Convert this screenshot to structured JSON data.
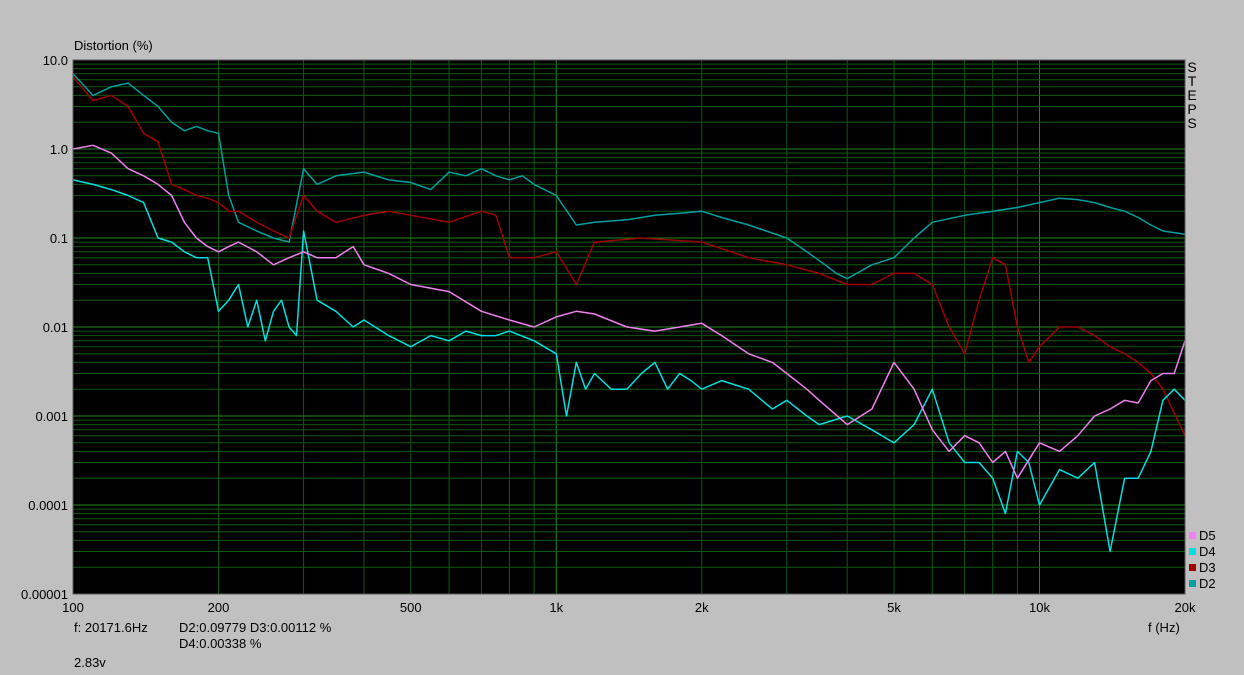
{
  "chart_data": {
    "type": "line",
    "title": "",
    "ylabel": "Distortion (%)",
    "xlabel": "f (Hz)",
    "x_scale": "log",
    "y_scale": "log",
    "xlim": [
      100,
      20000
    ],
    "ylim": [
      1e-05,
      10
    ],
    "grid": true,
    "legend_position": "bottom-right",
    "x_ticks": [
      {
        "value": 100,
        "label": "100"
      },
      {
        "value": 200,
        "label": "200"
      },
      {
        "value": 500,
        "label": "500"
      },
      {
        "value": 1000,
        "label": "1k"
      },
      {
        "value": 2000,
        "label": "2k"
      },
      {
        "value": 5000,
        "label": "5k"
      },
      {
        "value": 10000,
        "label": "10k"
      },
      {
        "value": 20000,
        "label": "20k"
      }
    ],
    "y_ticks": [
      {
        "value": 10,
        "label": "10.0"
      },
      {
        "value": 1,
        "label": "1.0"
      },
      {
        "value": 0.1,
        "label": "0.1"
      },
      {
        "value": 0.01,
        "label": "0.01"
      },
      {
        "value": 0.001,
        "label": "0.001"
      },
      {
        "value": 0.0001,
        "label": "0.0001"
      },
      {
        "value": 1e-05,
        "label": "0.00001"
      }
    ],
    "series": [
      {
        "name": "D2",
        "color": "#00a0a0",
        "x": [
          100,
          110,
          120,
          130,
          140,
          150,
          160,
          170,
          180,
          190,
          200,
          210,
          220,
          240,
          260,
          280,
          300,
          320,
          350,
          400,
          450,
          500,
          550,
          600,
          650,
          700,
          750,
          800,
          850,
          900,
          1000,
          1100,
          1200,
          1400,
          1600,
          1800,
          2000,
          2200,
          2500,
          3000,
          3300,
          3600,
          3800,
          4000,
          4500,
          5000,
          5500,
          6000,
          7000,
          8000,
          9000,
          10000,
          11000,
          12000,
          13000,
          14000,
          15000,
          16000,
          17000,
          18000,
          20000
        ],
        "y": [
          7,
          4,
          5,
          5.5,
          4,
          3,
          2,
          1.6,
          1.8,
          1.6,
          1.5,
          0.3,
          0.15,
          0.12,
          0.1,
          0.09,
          0.6,
          0.4,
          0.5,
          0.55,
          0.45,
          0.42,
          0.35,
          0.55,
          0.5,
          0.6,
          0.5,
          0.45,
          0.5,
          0.4,
          0.3,
          0.14,
          0.15,
          0.16,
          0.18,
          0.19,
          0.2,
          0.17,
          0.14,
          0.1,
          0.07,
          0.05,
          0.04,
          0.035,
          0.05,
          0.06,
          0.1,
          0.15,
          0.18,
          0.2,
          0.22,
          0.25,
          0.28,
          0.27,
          0.25,
          0.22,
          0.2,
          0.17,
          0.14,
          0.12,
          0.11
        ]
      },
      {
        "name": "D3",
        "color": "#a00000",
        "x": [
          100,
          110,
          120,
          130,
          140,
          150,
          160,
          170,
          180,
          190,
          200,
          210,
          220,
          240,
          260,
          280,
          300,
          320,
          350,
          400,
          450,
          500,
          600,
          700,
          750,
          800,
          900,
          1000,
          1100,
          1200,
          1500,
          2000,
          2500,
          3000,
          3500,
          4000,
          4500,
          5000,
          5500,
          6000,
          6500,
          7000,
          7500,
          8000,
          8500,
          9000,
          9500,
          10000,
          11000,
          12000,
          13000,
          14000,
          15000,
          16000,
          17000,
          18000,
          20000
        ],
        "y": [
          6.5,
          3.5,
          4,
          3,
          1.5,
          1.2,
          0.4,
          0.35,
          0.3,
          0.28,
          0.25,
          0.2,
          0.2,
          0.15,
          0.12,
          0.1,
          0.3,
          0.2,
          0.15,
          0.18,
          0.2,
          0.18,
          0.15,
          0.2,
          0.18,
          0.06,
          0.06,
          0.07,
          0.03,
          0.09,
          0.1,
          0.09,
          0.06,
          0.05,
          0.04,
          0.03,
          0.03,
          0.04,
          0.04,
          0.03,
          0.01,
          0.005,
          0.02,
          0.06,
          0.05,
          0.01,
          0.004,
          0.006,
          0.01,
          0.01,
          0.008,
          0.006,
          0.005,
          0.004,
          0.003,
          0.002,
          0.0006
        ]
      },
      {
        "name": "D4",
        "color": "#00e0e0",
        "x": [
          100,
          110,
          120,
          130,
          140,
          150,
          160,
          170,
          180,
          190,
          200,
          210,
          220,
          230,
          240,
          250,
          260,
          270,
          280,
          290,
          300,
          320,
          350,
          380,
          400,
          450,
          500,
          550,
          600,
          650,
          700,
          750,
          800,
          900,
          1000,
          1050,
          1100,
          1150,
          1200,
          1300,
          1400,
          1500,
          1600,
          1700,
          1800,
          1900,
          2000,
          2200,
          2500,
          2800,
          3000,
          3300,
          3500,
          4000,
          4500,
          5000,
          5500,
          6000,
          6500,
          7000,
          7500,
          8000,
          8500,
          9000,
          9500,
          10000,
          11000,
          12000,
          13000,
          14000,
          15000,
          16000,
          17000,
          18000,
          19000,
          20000
        ],
        "y": [
          0.45,
          0.4,
          0.35,
          0.3,
          0.25,
          0.1,
          0.09,
          0.07,
          0.06,
          0.06,
          0.015,
          0.02,
          0.03,
          0.01,
          0.02,
          0.007,
          0.015,
          0.02,
          0.01,
          0.008,
          0.12,
          0.02,
          0.015,
          0.01,
          0.012,
          0.008,
          0.006,
          0.008,
          0.007,
          0.009,
          0.008,
          0.008,
          0.009,
          0.007,
          0.005,
          0.001,
          0.004,
          0.002,
          0.003,
          0.002,
          0.002,
          0.003,
          0.004,
          0.002,
          0.003,
          0.0025,
          0.002,
          0.0025,
          0.002,
          0.0012,
          0.0015,
          0.001,
          0.0008,
          0.001,
          0.0007,
          0.0005,
          0.0008,
          0.002,
          0.0005,
          0.0003,
          0.0003,
          0.0002,
          8e-05,
          0.0004,
          0.0003,
          0.0001,
          0.00025,
          0.0002,
          0.0003,
          3e-05,
          0.0002,
          0.0002,
          0.0004,
          0.0015,
          0.002,
          0.0015
        ]
      },
      {
        "name": "D5",
        "color": "#f080f0",
        "x": [
          100,
          110,
          120,
          130,
          140,
          150,
          160,
          170,
          180,
          190,
          200,
          210,
          220,
          240,
          260,
          280,
          300,
          320,
          350,
          380,
          400,
          450,
          500,
          600,
          700,
          800,
          900,
          1000,
          1100,
          1200,
          1400,
          1600,
          1800,
          2000,
          2200,
          2500,
          2800,
          3000,
          3300,
          3500,
          4000,
          4500,
          5000,
          5500,
          6000,
          6500,
          7000,
          7500,
          8000,
          8500,
          9000,
          10000,
          11000,
          12000,
          13000,
          14000,
          15000,
          16000,
          17000,
          18000,
          19000,
          20000
        ],
        "y": [
          1,
          1.1,
          0.9,
          0.6,
          0.5,
          0.4,
          0.3,
          0.15,
          0.1,
          0.08,
          0.07,
          0.08,
          0.09,
          0.07,
          0.05,
          0.06,
          0.07,
          0.06,
          0.06,
          0.08,
          0.05,
          0.04,
          0.03,
          0.025,
          0.015,
          0.012,
          0.01,
          0.013,
          0.015,
          0.014,
          0.01,
          0.009,
          0.01,
          0.011,
          0.008,
          0.005,
          0.004,
          0.003,
          0.002,
          0.0015,
          0.0008,
          0.0012,
          0.004,
          0.002,
          0.0007,
          0.0004,
          0.0006,
          0.0005,
          0.0003,
          0.0004,
          0.0002,
          0.0005,
          0.0004,
          0.0006,
          0.001,
          0.0012,
          0.0015,
          0.0014,
          0.0025,
          0.003,
          0.003,
          0.007
        ]
      }
    ]
  },
  "readout": {
    "frequency": "f: 20171.6Hz",
    "line1": "D2:0.09779  D3:0.00112 %",
    "line2": "D4:0.00338   %",
    "level": "2.83v"
  },
  "side_label": "STEPS"
}
